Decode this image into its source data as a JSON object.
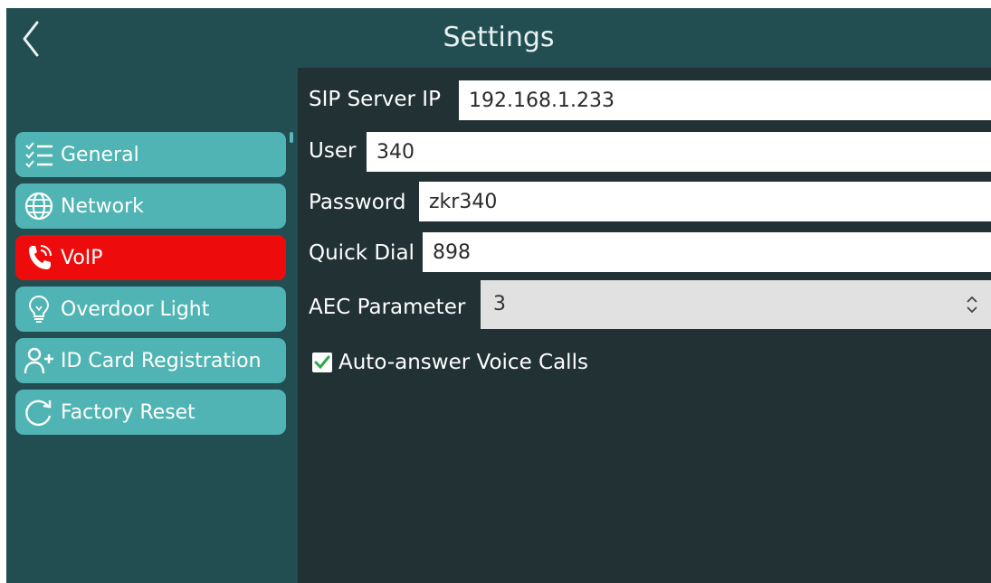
{
  "header": {
    "title": "Settings",
    "back_icon": "chevron-left-icon"
  },
  "sidebar": {
    "items": [
      {
        "label": "General",
        "icon": "checklist-icon",
        "active": false
      },
      {
        "label": "Network",
        "icon": "globe-icon",
        "active": false
      },
      {
        "label": "VoIP",
        "icon": "phone-call-icon",
        "active": true
      },
      {
        "label": "Overdoor Light",
        "icon": "lightbulb-icon",
        "active": false
      },
      {
        "label": "ID Card Registration",
        "icon": "add-user-icon",
        "active": false
      },
      {
        "label": "Factory Reset",
        "icon": "reset-icon",
        "active": false
      }
    ]
  },
  "form": {
    "sip_server_ip": {
      "label": "SIP Server IP",
      "value": "192.168.1.233"
    },
    "user": {
      "label": "User",
      "value": "340"
    },
    "password": {
      "label": "Password",
      "value": "zkr340"
    },
    "quick_dial": {
      "label": "Quick Dial",
      "value": "898"
    },
    "aec_parameter": {
      "label": "AEC Parameter",
      "value": "3"
    },
    "auto_answer": {
      "label": "Auto-answer Voice Calls",
      "checked": true
    }
  },
  "colors": {
    "header_bg": "#224d51",
    "sidebar_bg": "#224d51",
    "content_bg": "#213134",
    "nav_item": "#51b4b4",
    "nav_active": "#ee0b0b",
    "check_accent": "#2ea84a"
  }
}
